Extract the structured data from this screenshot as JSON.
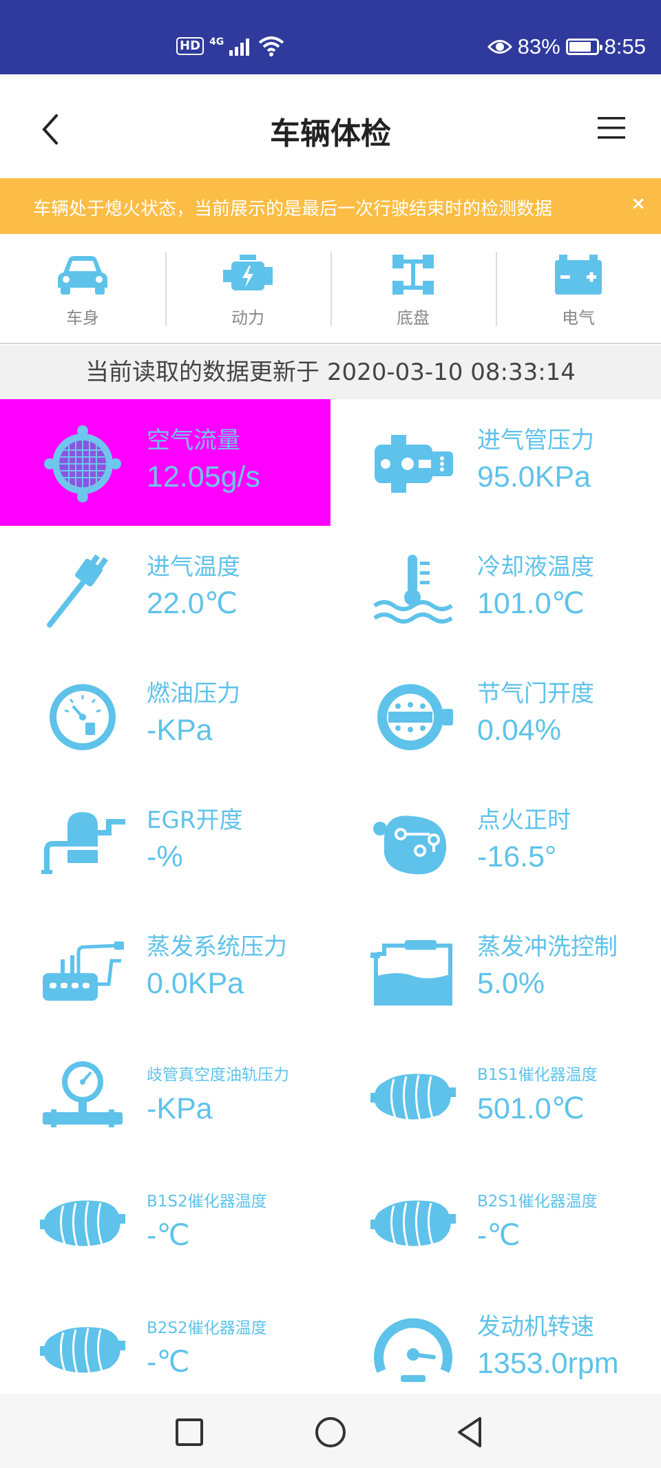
{
  "status_bar": {
    "hd": "HD",
    "network": "4G",
    "battery": "83%",
    "time": "8:55",
    "battery_level": 0.83
  },
  "header": {
    "title": "车辆体检"
  },
  "notice": {
    "text": "车辆处于熄火状态，当前展示的是最后一次行驶结束时的检测数据",
    "close": "×"
  },
  "categories": [
    {
      "label": "车身",
      "icon": "car-icon"
    },
    {
      "label": "动力",
      "icon": "engine-icon"
    },
    {
      "label": "底盘",
      "icon": "chassis-icon"
    },
    {
      "label": "电气",
      "icon": "battery-icon"
    }
  ],
  "update": {
    "text": "当前读取的数据更新于 2020-03-10 08:33:14"
  },
  "readings": [
    {
      "label": "空气流量",
      "value": "12.05g/s",
      "icon": "air-flow-sensor-icon"
    },
    {
      "label": "进气管压力",
      "value": "95.0KPa",
      "icon": "map-sensor-icon"
    },
    {
      "label": "进气温度",
      "value": "22.0℃",
      "icon": "temperature-probe-icon"
    },
    {
      "label": "冷却液温度",
      "value": "101.0℃",
      "icon": "coolant-temperature-icon"
    },
    {
      "label": "燃油压力",
      "value": "-KPa",
      "icon": "fuel-pressure-gauge-icon"
    },
    {
      "label": "节气门开度",
      "value": "0.04%",
      "icon": "throttle-body-icon"
    },
    {
      "label": "EGR开度",
      "value": "-%",
      "icon": "egr-valve-icon"
    },
    {
      "label": "点火正时",
      "value": "-16.5°",
      "icon": "ignition-timing-icon"
    },
    {
      "label": "蒸发系统压力",
      "value": "0.0KPa",
      "icon": "evap-pressure-icon"
    },
    {
      "label": "蒸发冲洗控制",
      "value": "5.0%",
      "icon": "evap-purge-tank-icon"
    },
    {
      "label": "歧管真空度油轨压力",
      "value": "-KPa",
      "icon": "vacuum-gauge-icon"
    },
    {
      "label": "B1S1催化器温度",
      "value": "501.0℃",
      "icon": "catalyst-icon"
    },
    {
      "label": "B1S2催化器温度",
      "value": "-℃",
      "icon": "catalyst-icon"
    },
    {
      "label": "B2S1催化器温度",
      "value": "-℃",
      "icon": "catalyst-icon"
    },
    {
      "label": "B2S2催化器温度",
      "value": "-℃",
      "icon": "catalyst-icon"
    },
    {
      "label": "发动机转速",
      "value": "1353.0rpm",
      "icon": "tachometer-icon"
    }
  ],
  "colors": {
    "status_bar": "#2f3a9c",
    "notice": "#fbbd45",
    "accent": "#5ec2ea",
    "selected": "#ff00ff"
  }
}
